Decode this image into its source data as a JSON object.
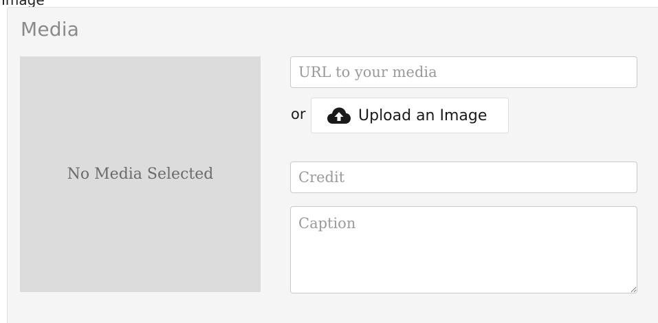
{
  "page_header_fragment": "Image",
  "media": {
    "title": "Media",
    "preview_text": "No Media Selected",
    "url_placeholder": "URL to your media",
    "or_text": "or",
    "upload_button_label": "Upload an Image",
    "upload_icon": "cloud-upload-icon",
    "credit_placeholder": "Credit",
    "caption_placeholder": "Caption"
  }
}
